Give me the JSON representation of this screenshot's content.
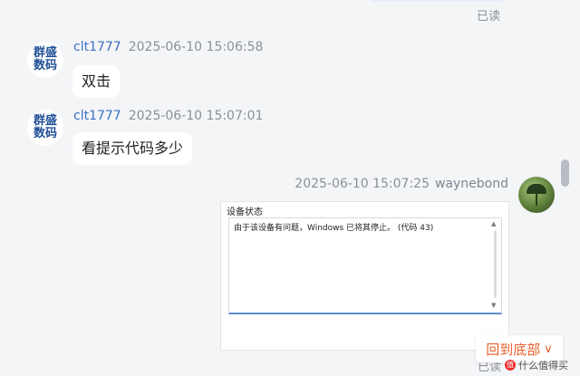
{
  "top": {
    "read_status": "已读"
  },
  "messages": [
    {
      "avatar_text": [
        "群盛",
        "数码"
      ],
      "username": "clt1777",
      "timestamp": "2025-06-10 15:06:58",
      "text": "双击"
    },
    {
      "avatar_text": [
        "群盛",
        "数码"
      ],
      "username": "clt1777",
      "timestamp": "2025-06-10 15:07:01",
      "text": "看提示代码多少"
    }
  ],
  "reply": {
    "timestamp": "2025-06-10 15:07:25",
    "username": "waynebond",
    "image": {
      "title": "设备状态",
      "message": "由于该设备有问题，Windows 已将其停止。 (代码 43)"
    }
  },
  "back_to_bottom": {
    "label": "回到底部",
    "icon": "chevron-down-icon"
  },
  "bottom": {
    "read_status": "已读"
  },
  "watermark": {
    "logo": "值",
    "text": "什么值得买"
  },
  "colors": {
    "accent": "#e8602c",
    "username": "#3b6fc7",
    "brand": "#1f4e96"
  }
}
